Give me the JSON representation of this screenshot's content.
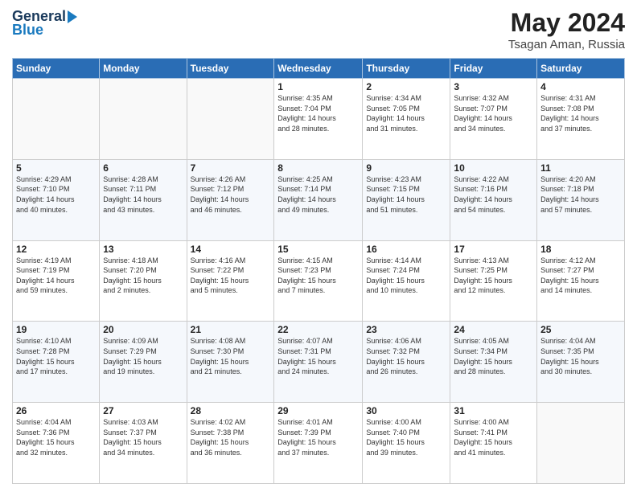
{
  "header": {
    "logo_general": "General",
    "logo_blue": "Blue",
    "month_year": "May 2024",
    "location": "Tsagan Aman, Russia"
  },
  "days_of_week": [
    "Sunday",
    "Monday",
    "Tuesday",
    "Wednesday",
    "Thursday",
    "Friday",
    "Saturday"
  ],
  "weeks": [
    [
      {
        "day": "",
        "info": ""
      },
      {
        "day": "",
        "info": ""
      },
      {
        "day": "",
        "info": ""
      },
      {
        "day": "1",
        "info": "Sunrise: 4:35 AM\nSunset: 7:04 PM\nDaylight: 14 hours\nand 28 minutes."
      },
      {
        "day": "2",
        "info": "Sunrise: 4:34 AM\nSunset: 7:05 PM\nDaylight: 14 hours\nand 31 minutes."
      },
      {
        "day": "3",
        "info": "Sunrise: 4:32 AM\nSunset: 7:07 PM\nDaylight: 14 hours\nand 34 minutes."
      },
      {
        "day": "4",
        "info": "Sunrise: 4:31 AM\nSunset: 7:08 PM\nDaylight: 14 hours\nand 37 minutes."
      }
    ],
    [
      {
        "day": "5",
        "info": "Sunrise: 4:29 AM\nSunset: 7:10 PM\nDaylight: 14 hours\nand 40 minutes."
      },
      {
        "day": "6",
        "info": "Sunrise: 4:28 AM\nSunset: 7:11 PM\nDaylight: 14 hours\nand 43 minutes."
      },
      {
        "day": "7",
        "info": "Sunrise: 4:26 AM\nSunset: 7:12 PM\nDaylight: 14 hours\nand 46 minutes."
      },
      {
        "day": "8",
        "info": "Sunrise: 4:25 AM\nSunset: 7:14 PM\nDaylight: 14 hours\nand 49 minutes."
      },
      {
        "day": "9",
        "info": "Sunrise: 4:23 AM\nSunset: 7:15 PM\nDaylight: 14 hours\nand 51 minutes."
      },
      {
        "day": "10",
        "info": "Sunrise: 4:22 AM\nSunset: 7:16 PM\nDaylight: 14 hours\nand 54 minutes."
      },
      {
        "day": "11",
        "info": "Sunrise: 4:20 AM\nSunset: 7:18 PM\nDaylight: 14 hours\nand 57 minutes."
      }
    ],
    [
      {
        "day": "12",
        "info": "Sunrise: 4:19 AM\nSunset: 7:19 PM\nDaylight: 14 hours\nand 59 minutes."
      },
      {
        "day": "13",
        "info": "Sunrise: 4:18 AM\nSunset: 7:20 PM\nDaylight: 15 hours\nand 2 minutes."
      },
      {
        "day": "14",
        "info": "Sunrise: 4:16 AM\nSunset: 7:22 PM\nDaylight: 15 hours\nand 5 minutes."
      },
      {
        "day": "15",
        "info": "Sunrise: 4:15 AM\nSunset: 7:23 PM\nDaylight: 15 hours\nand 7 minutes."
      },
      {
        "day": "16",
        "info": "Sunrise: 4:14 AM\nSunset: 7:24 PM\nDaylight: 15 hours\nand 10 minutes."
      },
      {
        "day": "17",
        "info": "Sunrise: 4:13 AM\nSunset: 7:25 PM\nDaylight: 15 hours\nand 12 minutes."
      },
      {
        "day": "18",
        "info": "Sunrise: 4:12 AM\nSunset: 7:27 PM\nDaylight: 15 hours\nand 14 minutes."
      }
    ],
    [
      {
        "day": "19",
        "info": "Sunrise: 4:10 AM\nSunset: 7:28 PM\nDaylight: 15 hours\nand 17 minutes."
      },
      {
        "day": "20",
        "info": "Sunrise: 4:09 AM\nSunset: 7:29 PM\nDaylight: 15 hours\nand 19 minutes."
      },
      {
        "day": "21",
        "info": "Sunrise: 4:08 AM\nSunset: 7:30 PM\nDaylight: 15 hours\nand 21 minutes."
      },
      {
        "day": "22",
        "info": "Sunrise: 4:07 AM\nSunset: 7:31 PM\nDaylight: 15 hours\nand 24 minutes."
      },
      {
        "day": "23",
        "info": "Sunrise: 4:06 AM\nSunset: 7:32 PM\nDaylight: 15 hours\nand 26 minutes."
      },
      {
        "day": "24",
        "info": "Sunrise: 4:05 AM\nSunset: 7:34 PM\nDaylight: 15 hours\nand 28 minutes."
      },
      {
        "day": "25",
        "info": "Sunrise: 4:04 AM\nSunset: 7:35 PM\nDaylight: 15 hours\nand 30 minutes."
      }
    ],
    [
      {
        "day": "26",
        "info": "Sunrise: 4:04 AM\nSunset: 7:36 PM\nDaylight: 15 hours\nand 32 minutes."
      },
      {
        "day": "27",
        "info": "Sunrise: 4:03 AM\nSunset: 7:37 PM\nDaylight: 15 hours\nand 34 minutes."
      },
      {
        "day": "28",
        "info": "Sunrise: 4:02 AM\nSunset: 7:38 PM\nDaylight: 15 hours\nand 36 minutes."
      },
      {
        "day": "29",
        "info": "Sunrise: 4:01 AM\nSunset: 7:39 PM\nDaylight: 15 hours\nand 37 minutes."
      },
      {
        "day": "30",
        "info": "Sunrise: 4:00 AM\nSunset: 7:40 PM\nDaylight: 15 hours\nand 39 minutes."
      },
      {
        "day": "31",
        "info": "Sunrise: 4:00 AM\nSunset: 7:41 PM\nDaylight: 15 hours\nand 41 minutes."
      },
      {
        "day": "",
        "info": ""
      }
    ]
  ]
}
